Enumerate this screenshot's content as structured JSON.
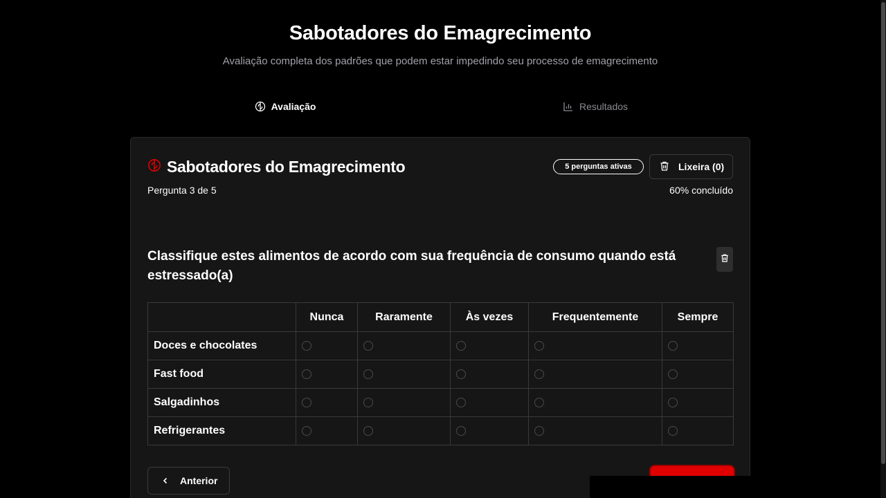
{
  "header": {
    "title": "Sabotadores do Emagrecimento",
    "subtitle": "Avaliação completa dos padrões que podem estar impedindo seu processo de emagrecimento"
  },
  "tabs": [
    {
      "label": "Avaliação",
      "icon": "brain-icon",
      "active": true
    },
    {
      "label": "Resultados",
      "icon": "bar-chart-icon",
      "active": false
    }
  ],
  "card": {
    "title": "Sabotadores do Emagrecimento",
    "title_icon": "brain-icon",
    "badge": "5 perguntas ativas",
    "trash_label": "Lixeira (0)",
    "progress_label": "Pergunta 3 de 5",
    "progress_percent_label": "60% concluído",
    "progress_fraction": 0.6
  },
  "question": {
    "text": "Classifique estes alimentos de acordo com sua frequência de consumo quando está estressado(a)",
    "columns": [
      "Nunca",
      "Raramente",
      "Às vezes",
      "Frequentemente",
      "Sempre"
    ],
    "rows": [
      "Doces e chocolates",
      "Fast food",
      "Salgadinhos",
      "Refrigerantes"
    ]
  },
  "nav": {
    "prev_label": "Anterior"
  },
  "colors": {
    "background": "#000000",
    "card": "#161616",
    "accent": "#e00000",
    "muted_text": "#a1a1aa"
  }
}
